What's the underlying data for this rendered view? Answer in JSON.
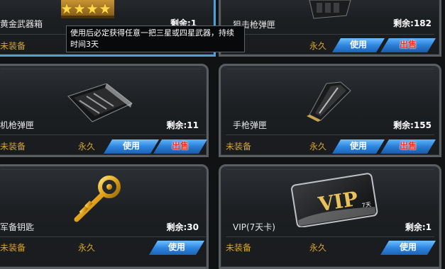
{
  "items": [
    {
      "name": "黄金武器箱",
      "remain": "剩余:1",
      "status": "未装备",
      "duration": "",
      "use": "",
      "sell": ""
    },
    {
      "name": "狙击枪弹匣",
      "remain": "剩余:182",
      "status": "",
      "duration": "永久",
      "use": "使用",
      "sell": "出售"
    },
    {
      "name": "机枪弹匣",
      "remain": "剩余:11",
      "status": "未装备",
      "duration": "永久",
      "use": "使用",
      "sell": "出售"
    },
    {
      "name": "手枪弹匣",
      "remain": "剩余:155",
      "status": "未装备",
      "duration": "永久",
      "use": "使用",
      "sell": "出售"
    },
    {
      "name": "军备钥匙",
      "remain": "剩余:30",
      "status": "未装备",
      "duration": "永久",
      "use": "使用",
      "sell": ""
    },
    {
      "name": "VIP(7天卡)",
      "remain": "剩余:1",
      "status": "未装备",
      "duration": "永久",
      "use": "使用",
      "sell": ""
    }
  ],
  "tooltip": {
    "line1": "使用后必定获得任意一把三星或四星武器，持续",
    "line2": "时间3天"
  },
  "vip_card": {
    "logo": "VIP",
    "days": "7天"
  },
  "colors": {
    "accent_blue": "#2f86e0",
    "sell_red": "#ff2a1a",
    "gold_text": "#d6a531"
  },
  "icons": [
    "gold-weapon-box-icon",
    "sniper-magazine-icon",
    "machine-gun-magazine-icon",
    "pistol-magazine-icon",
    "gold-key-icon",
    "vip-card-icon"
  ]
}
